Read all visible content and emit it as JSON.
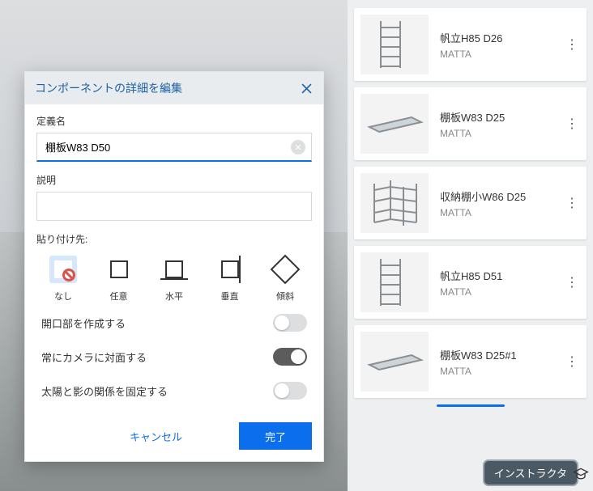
{
  "dialog": {
    "title": "コンポーネントの詳細を編集",
    "definition_label": "定義名",
    "definition_value": "棚板W83 D50",
    "description_label": "説明",
    "description_value": "",
    "glue_label": "貼り付け先:",
    "glue_options": {
      "none": "なし",
      "any": "任意",
      "horizontal": "水平",
      "vertical": "垂直",
      "sloped": "傾斜"
    },
    "opt_cut_opening": "開口部を作成する",
    "opt_face_camera": "常にカメラに対面する",
    "opt_shadows_face_sun": "太陽と影の関係を固定する",
    "cancel": "キャンセル",
    "done": "完了"
  },
  "component_list": [
    {
      "name": "帆立H85 D26",
      "author": "MATTA",
      "thumb": "upright"
    },
    {
      "name": "棚板W83 D25",
      "author": "MATTA",
      "thumb": "shelf"
    },
    {
      "name": "収納棚小W86 D25",
      "author": "MATTA",
      "thumb": "rack"
    },
    {
      "name": "帆立H85 D51",
      "author": "MATTA",
      "thumb": "upright"
    },
    {
      "name": "棚板W83 D25#1",
      "author": "MATTA",
      "thumb": "shelf"
    }
  ],
  "instructor_label": "インストラクタ"
}
